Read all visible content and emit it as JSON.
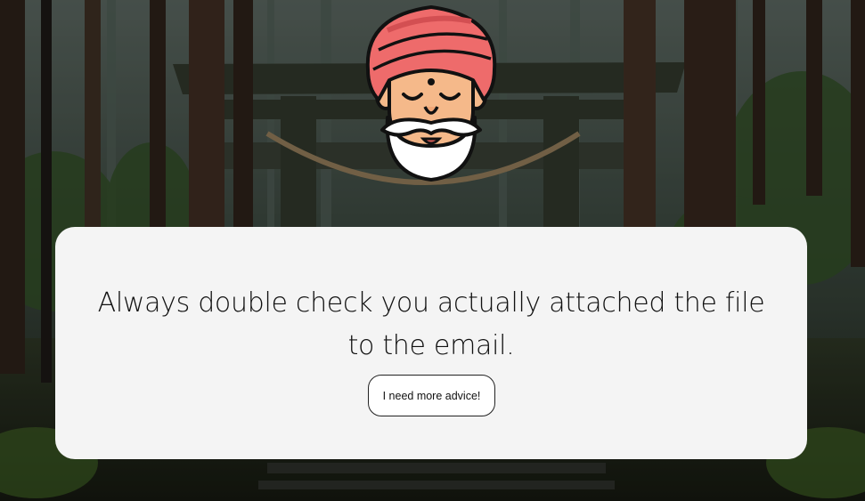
{
  "background": {
    "scene": "forest shrine torii gate"
  },
  "mascot": {
    "icon": "turbaned-sage-icon",
    "turban_color": "#ee6b6b",
    "skin_color": "#f5b98a",
    "beard_color": "#ffffff"
  },
  "card": {
    "quote": "Always double check you actually attached the file to the email.",
    "button_label": "I need more advice!",
    "background_color": "#f4f4f4"
  }
}
